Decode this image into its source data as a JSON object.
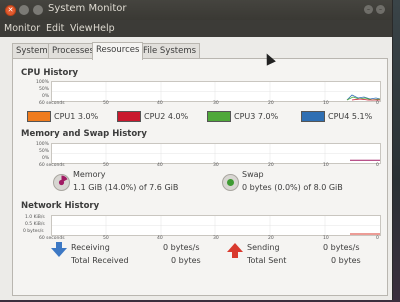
{
  "window": {
    "title": "System Monitor"
  },
  "menu": [
    "Monitor",
    "Edit",
    "View",
    "Help"
  ],
  "tabs": [
    "System",
    "Processes",
    "Resources",
    "File Systems"
  ],
  "active_tab": "Resources",
  "cpu": {
    "title": "CPU History",
    "y_top": "100%",
    "y_mid": "50%",
    "y_bottom": "0%",
    "x_ticks": [
      "60 seconds",
      "50",
      "40",
      "30",
      "20",
      "10",
      "0"
    ],
    "cores": [
      {
        "label": "CPU1 3.0%",
        "color": "#f07c1e"
      },
      {
        "label": "CPU2 4.0%",
        "color": "#c9182d"
      },
      {
        "label": "CPU3 7.0%",
        "color": "#4fa83a"
      },
      {
        "label": "CPU4 5.1%",
        "color": "#2f6fb3"
      }
    ]
  },
  "memory": {
    "title": "Memory and Swap History",
    "y_top": "100%",
    "y_mid": "50%",
    "y_bottom": "0%",
    "x_ticks": [
      "60 seconds",
      "50",
      "40",
      "30",
      "20",
      "10",
      "0"
    ],
    "memory_label": "Memory",
    "memory_value": "1.1 GiB (14.0%) of 7.6 GiB",
    "memory_color": "#a01a63",
    "swap_label": "Swap",
    "swap_value": "0 bytes (0.0%) of 8.0 GiB",
    "swap_color": "#3e9a32"
  },
  "network": {
    "title": "Network History",
    "y_top": "1.0 KiB/s",
    "y_mid": "0.5 KiB/s",
    "y_bottom": "0 bytes/s",
    "x_ticks": [
      "60 seconds",
      "50",
      "40",
      "30",
      "20",
      "10",
      "0"
    ],
    "receiving_label": "Receiving",
    "receiving_value": "0 bytes/s",
    "total_received_label": "Total Received",
    "total_received_value": "0 bytes",
    "sending_label": "Sending",
    "sending_value": "0 bytes/s",
    "total_sent_label": "Total Sent",
    "total_sent_value": "0 bytes"
  }
}
